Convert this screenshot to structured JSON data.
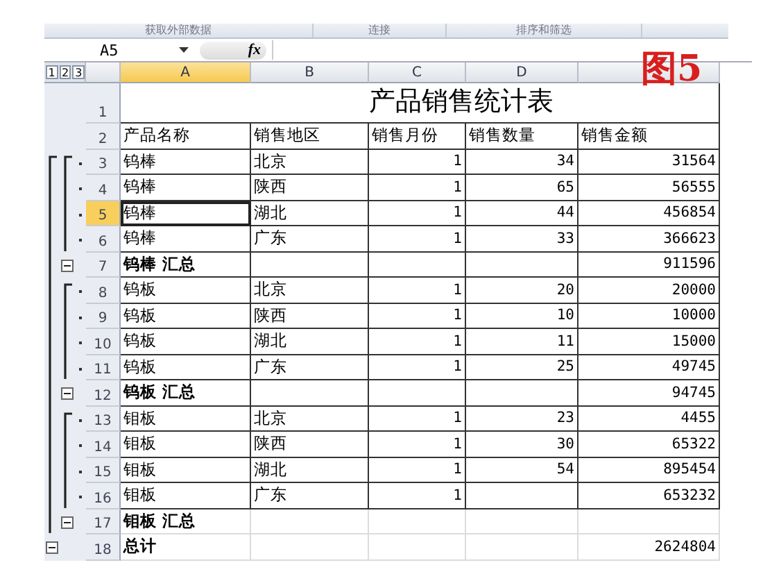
{
  "ribbon_groups": [
    "获取外部数据",
    "连接",
    "排序和筛选"
  ],
  "name_box": "A5",
  "function_button": "fx",
  "outline_levels": [
    "1",
    "2",
    "3"
  ],
  "columns": [
    {
      "label": "A",
      "selected": true
    },
    {
      "label": "B",
      "selected": false
    },
    {
      "label": "C",
      "selected": false
    },
    {
      "label": "D",
      "selected": false
    }
  ],
  "figure_label": "图5",
  "rows": [
    {
      "number": "1",
      "kind": "title",
      "selected": false,
      "cells": [
        "产品销售统计表"
      ]
    },
    {
      "number": "2",
      "kind": "header",
      "selected": false,
      "cells": [
        "产品名称",
        "销售地区",
        "销售月份",
        "销售数量",
        "销售金额"
      ]
    },
    {
      "number": "3",
      "kind": "detail",
      "selected": false,
      "cells": [
        "钨棒",
        "北京",
        "1",
        "34",
        "31564"
      ]
    },
    {
      "number": "4",
      "kind": "detail",
      "selected": false,
      "cells": [
        "钨棒",
        "陕西",
        "1",
        "65",
        "56555"
      ]
    },
    {
      "number": "5",
      "kind": "detail",
      "selected": true,
      "cells": [
        "钨棒",
        "湖北",
        "1",
        "44",
        "456854"
      ]
    },
    {
      "number": "6",
      "kind": "detail",
      "selected": false,
      "cells": [
        "钨棒",
        "广东",
        "1",
        "33",
        "366623"
      ]
    },
    {
      "number": "7",
      "kind": "subtotal",
      "expanded": true,
      "selected": false,
      "cells": [
        "钨棒 汇总",
        null,
        null,
        null,
        "911596"
      ]
    },
    {
      "number": "8",
      "kind": "detail",
      "selected": false,
      "cells": [
        "钨板",
        "北京",
        "1",
        "20",
        "20000"
      ]
    },
    {
      "number": "9",
      "kind": "detail",
      "selected": false,
      "cells": [
        "钨板",
        "陕西",
        "1",
        "10",
        "10000"
      ]
    },
    {
      "number": "10",
      "kind": "detail",
      "selected": false,
      "cells": [
        "钨板",
        "湖北",
        "1",
        "11",
        "15000"
      ]
    },
    {
      "number": "11",
      "kind": "detail",
      "selected": false,
      "cells": [
        "钨板",
        "广东",
        "1",
        "25",
        "49745"
      ]
    },
    {
      "number": "12",
      "kind": "subtotal",
      "expanded": true,
      "selected": false,
      "cells": [
        "钨板 汇总",
        null,
        null,
        null,
        "94745"
      ]
    },
    {
      "number": "13",
      "kind": "detail",
      "selected": false,
      "cells": [
        "钼板",
        "北京",
        "1",
        "23",
        "4455"
      ]
    },
    {
      "number": "14",
      "kind": "detail",
      "selected": false,
      "cells": [
        "钼板",
        "陕西",
        "1",
        "30",
        "65322"
      ]
    },
    {
      "number": "15",
      "kind": "detail",
      "selected": false,
      "cells": [
        "钼板",
        "湖北",
        "1",
        "54",
        "895454"
      ]
    },
    {
      "number": "16",
      "kind": "detail",
      "selected": false,
      "cells": [
        "钼板",
        "广东",
        "1",
        null,
        "653232"
      ]
    },
    {
      "number": "17",
      "kind": "subtotal",
      "expanded": true,
      "selected": false,
      "cells": [
        "钼板 汇总",
        null,
        null,
        null,
        null
      ]
    },
    {
      "number": "18",
      "kind": "grand_total",
      "expanded": true,
      "selected": false,
      "cells": [
        "总计",
        null,
        null,
        null,
        "2624804"
      ]
    }
  ]
}
